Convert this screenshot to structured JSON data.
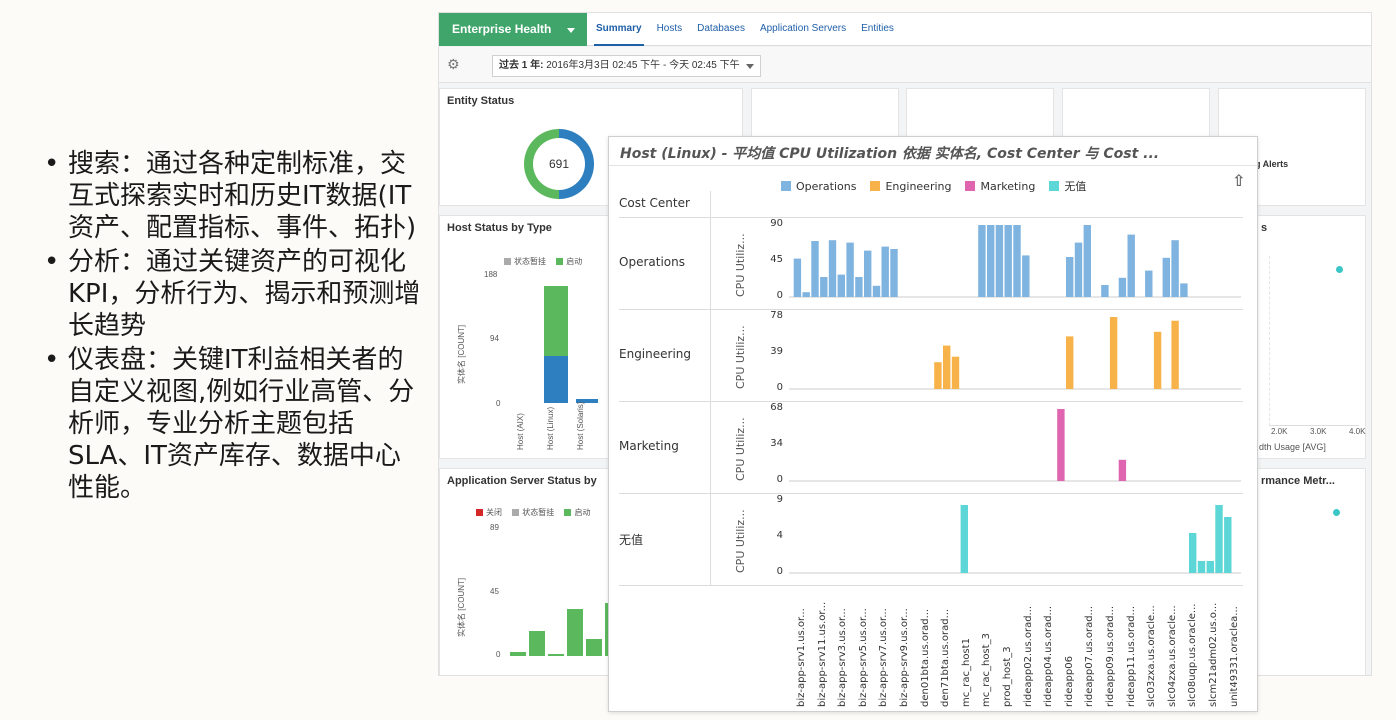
{
  "bullets": [
    "搜索：通过各种定制标准，交互式探索实时和历史IT数据(IT资产、配置指标、事件、拓扑)",
    "分析：通过关键资产的可视化KPI，分析行为、揭示和预测增长趋势",
    "仪表盘：关键IT利益相关者的自定义视图,例如行业高管、分析师，专业分析主题包括SLA、IT资产库存、数据中心性能。"
  ],
  "dashboard": {
    "nav_button": "Enterprise Health",
    "tabs": [
      "Summary",
      "Hosts",
      "Databases",
      "Application Servers",
      "Entities"
    ],
    "active_tab": "Summary",
    "time_range_bold": "过去 1 年:",
    "time_range_text": "2016年3月3日 02:45 下午 - 今天 02:45 下午",
    "entity_status": {
      "title": "Entity Status",
      "count": "691"
    },
    "host_status": {
      "title": "Host Status by Type",
      "legend": [
        "状态暂挂",
        "启动"
      ],
      "ticks": [
        "188",
        "94",
        "0"
      ],
      "ylabel": "实体名 [COUNT]",
      "categories": [
        "Host (AIX)",
        "Host (Linux)",
        "Host (Solaris)"
      ]
    },
    "app_status": {
      "title": "Application Server Status by",
      "legend": [
        "关闭",
        "状态暂挂",
        "启动"
      ],
      "ticks": [
        "89",
        "45",
        "0"
      ],
      "ylabel": "实体名 [COUNT]"
    },
    "alerts_label": "g Alerts",
    "right_panel_1": {
      "title_fragment": "s",
      "ticks": [
        "2.0K",
        "3.0K",
        "4.0K"
      ],
      "xlabel": "dth Usage [AVG]"
    },
    "right_panel_2": {
      "title_fragment": "rmance Metr..."
    }
  },
  "overlay": {
    "title": "Host (Linux) - 平均值 CPU Utilization 依据 实体名, Cost Center 与 Cost ...",
    "cost_center_header": "Cost Center",
    "legend": [
      {
        "name": "Operations",
        "color": "#7fb3e0"
      },
      {
        "name": "Engineering",
        "color": "#f8b24a"
      },
      {
        "name": "Marketing",
        "color": "#e065b0"
      },
      {
        "name": "无值",
        "color": "#5cd6d6"
      }
    ],
    "y_axis_label": "CPU Utiliz...",
    "rows": [
      {
        "label": "Operations",
        "ticks": [
          "90",
          "45",
          "0"
        ],
        "max": 90
      },
      {
        "label": "Engineering",
        "ticks": [
          "78",
          "39",
          "0"
        ],
        "max": 78
      },
      {
        "label": "Marketing",
        "ticks": [
          "68",
          "34",
          "0"
        ],
        "max": 68
      },
      {
        "label": "无值",
        "ticks": [
          "9",
          "4",
          "0"
        ],
        "max": 9
      }
    ],
    "x_labels": [
      "biz-app-srv1.us.or...",
      "biz-app-srv11.us.or...",
      "biz-app-srv3.us.or...",
      "biz-app-srv5.us.or...",
      "biz-app-srv7.us.or...",
      "biz-app-srv9.us.or...",
      "den01bta.us.orad...",
      "den71bta.us.orad...",
      "mc_rac_host1",
      "mc_rac_host_3",
      "prod_host_3",
      "rideapp02.us.orad...",
      "rideapp04.us.orad...",
      "rideapp06",
      "rideapp07.us.orad...",
      "rideapp09.us.orad...",
      "rideapp11.us.orad...",
      "slc03zxa.us.oracle...",
      "slc04zxa.us.oracle...",
      "slc08uqp.us.oracle...",
      "slcm21adm02.us.o...",
      "unit49331.oraclea..."
    ]
  },
  "chart_data": {
    "type": "bar",
    "title": "Host (Linux) - 平均值 CPU Utilization 依据 实体名, Cost Center 与 Cost ...",
    "ylabel": "CPU Utiliz...",
    "series": [
      {
        "name": "Operations",
        "ylim": [
          0,
          90
        ],
        "values": [
          48,
          6,
          70,
          25,
          71,
          28,
          68,
          25,
          58,
          14,
          63,
          60,
          0,
          0,
          0,
          0,
          0,
          0,
          0,
          0,
          0,
          90,
          90,
          90,
          90,
          90,
          52,
          0,
          0,
          0,
          0,
          50,
          68,
          90,
          0,
          15,
          0,
          24,
          78,
          0,
          33,
          0,
          49,
          71,
          17,
          0,
          0,
          0,
          0,
          0,
          0
        ]
      },
      {
        "name": "Engineering",
        "ylim": [
          0,
          78
        ],
        "values": [
          0,
          0,
          0,
          0,
          0,
          0,
          0,
          0,
          0,
          0,
          0,
          0,
          0,
          0,
          0,
          0,
          29,
          47,
          35,
          0,
          0,
          0,
          0,
          0,
          0,
          0,
          0,
          0,
          0,
          0,
          0,
          57,
          0,
          0,
          0,
          0,
          78,
          0,
          0,
          0,
          0,
          62,
          0,
          74,
          0,
          0,
          0,
          0,
          0,
          0,
          0
        ]
      },
      {
        "name": "Marketing",
        "ylim": [
          0,
          68
        ],
        "values": [
          0,
          0,
          0,
          0,
          0,
          0,
          0,
          0,
          0,
          0,
          0,
          0,
          0,
          0,
          0,
          0,
          0,
          0,
          0,
          0,
          0,
          0,
          0,
          0,
          0,
          0,
          0,
          0,
          0,
          0,
          68,
          0,
          0,
          0,
          0,
          0,
          0,
          20,
          0,
          0,
          0,
          0,
          0,
          0,
          0,
          0,
          0,
          0,
          0,
          0,
          0
        ]
      },
      {
        "name": "无值",
        "ylim": [
          0,
          9
        ],
        "values": [
          0,
          0,
          0,
          0,
          0,
          0,
          0,
          0,
          0,
          0,
          0,
          0,
          0,
          0,
          0,
          0,
          0,
          0,
          0,
          8.5,
          0,
          0,
          0,
          0,
          0,
          0,
          0,
          0,
          0,
          0,
          0,
          0,
          0,
          0,
          0,
          0,
          0,
          0,
          0,
          0,
          0,
          0,
          0,
          0,
          0,
          5,
          1.5,
          1.5,
          8.5,
          7,
          0
        ]
      }
    ]
  }
}
